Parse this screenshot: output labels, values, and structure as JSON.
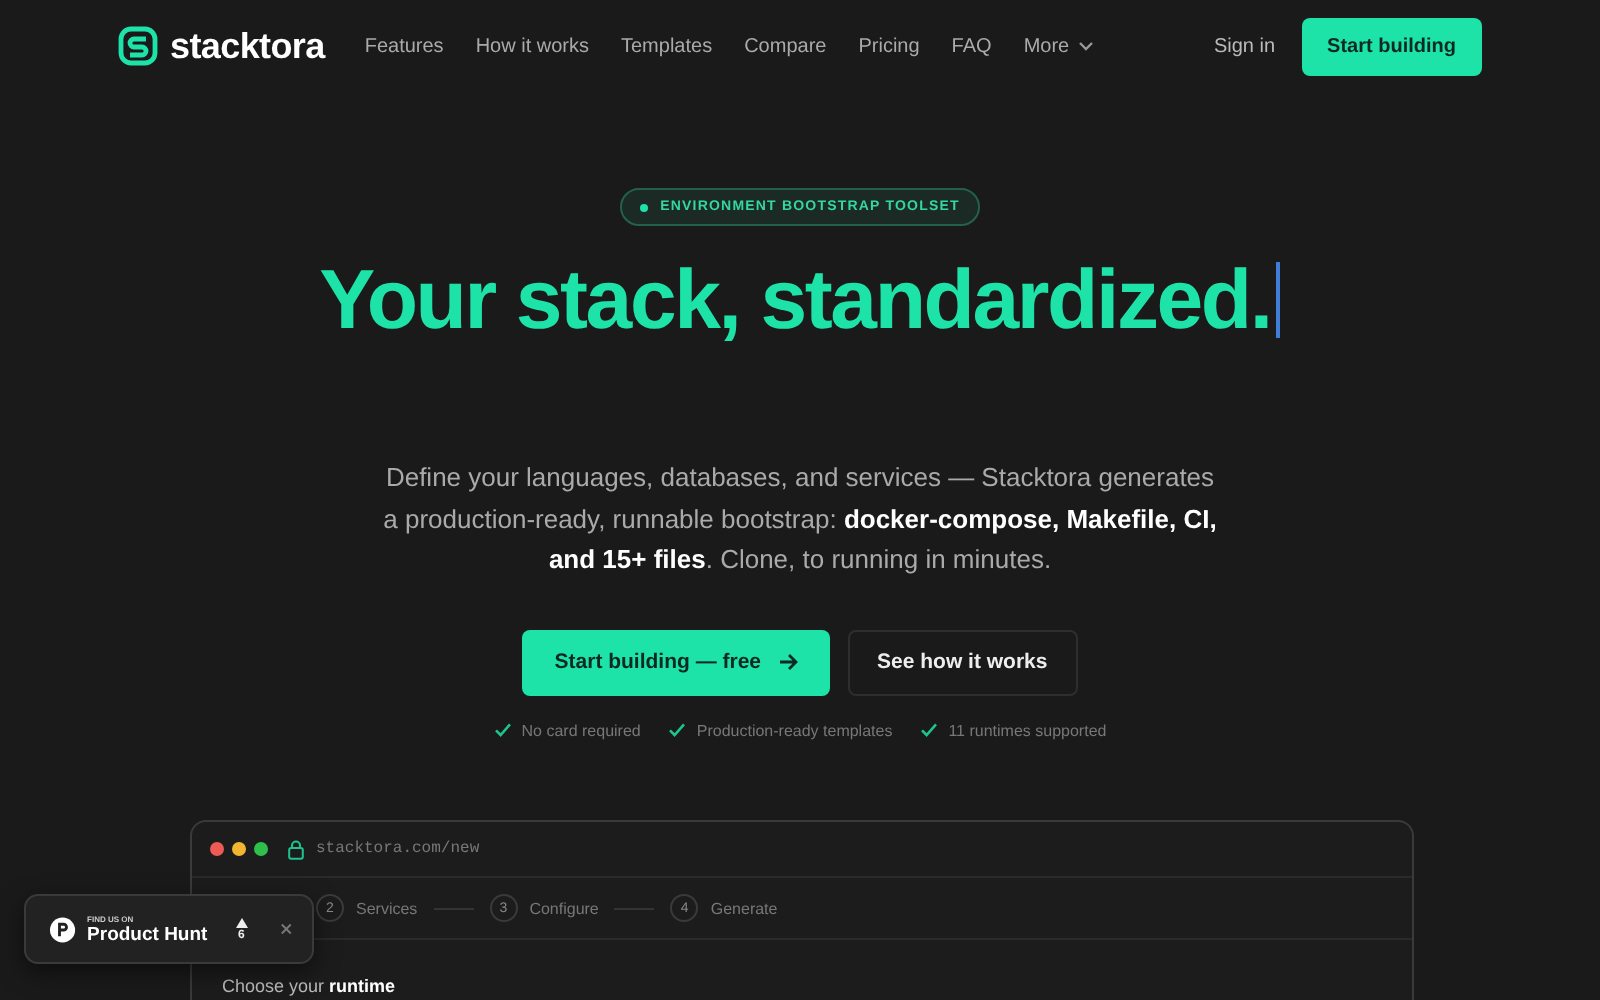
{
  "nav": {
    "brand": "stacktora",
    "links": [
      {
        "label": "Features",
        "kind": "link"
      },
      {
        "label": "How it works",
        "kind": "link"
      },
      {
        "label": "Templates",
        "kind": "link"
      },
      {
        "label": "Compare",
        "kind": "link"
      },
      {
        "label": "Pricing",
        "kind": "link"
      },
      {
        "label": "FAQ",
        "kind": "link"
      },
      {
        "label": "More",
        "kind": "dropdown"
      }
    ],
    "sign_in": "Sign in",
    "cta": "Start building"
  },
  "hero": {
    "badge": "ENVIRONMENT BOOTSTRAP TOOLSET",
    "headline": "Your stack, standardized.",
    "cursor": true,
    "description": "Define your languages, databases, and services — Stacktora generates a production-ready, runnable bootstrap: **docker-compose, Makefile, CI, and 15+ files**. Clone, to running in minutes.",
    "primary_button": "Start building — free",
    "secondary_button": "See how it works",
    "checks": [
      "No card required",
      "Production-ready templates",
      "11 runtimes supported"
    ]
  },
  "preview": {
    "url": "stacktora.com/new",
    "steps": [
      {
        "number": "2",
        "label": "Services",
        "selected": false
      },
      {
        "number": "3",
        "label": "Configure",
        "selected": false
      },
      {
        "number": "4",
        "label": "Generate",
        "selected": false
      }
    ],
    "heading": "Choose your **runtime**"
  },
  "product_hunt": {
    "kicker": "FIND US ON",
    "name": "Product Hunt",
    "votes": "6"
  }
}
